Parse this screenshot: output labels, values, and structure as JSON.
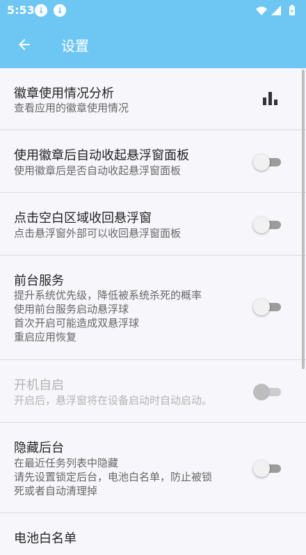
{
  "status": {
    "time": "5:53"
  },
  "toolbar": {
    "title": "设置"
  },
  "settings": [
    {
      "title": "徽章使用情况分析",
      "desc": "查看应用的徽章使用情况"
    },
    {
      "title": "使用徽章后自动收起悬浮窗面板",
      "desc": "使用徽章后是否自动收起悬浮窗面板",
      "checked": false
    },
    {
      "title": "点击空白区域收回悬浮窗",
      "desc": "点击悬浮窗外部可以收回悬浮窗面板",
      "checked": false
    },
    {
      "title": "前台服务",
      "desc_lines": [
        "提升系统优先级，降低被系统杀死的概率",
        "使用前台服务启动悬浮球",
        "首次开启可能造成双悬浮球",
        "重启应用恢复"
      ],
      "checked": false
    },
    {
      "title": "开机自启",
      "desc": "开启后，悬浮窗将在设备启动时自动启动。",
      "checked": false,
      "disabled": true
    },
    {
      "title": "隐藏后台",
      "desc_lines": [
        "在最近任务列表中隐藏",
        "请先设置锁定后台，电池白名单，防止被锁",
        "死或者自动清理掉"
      ],
      "checked": false
    },
    {
      "title": "电池白名单"
    }
  ]
}
